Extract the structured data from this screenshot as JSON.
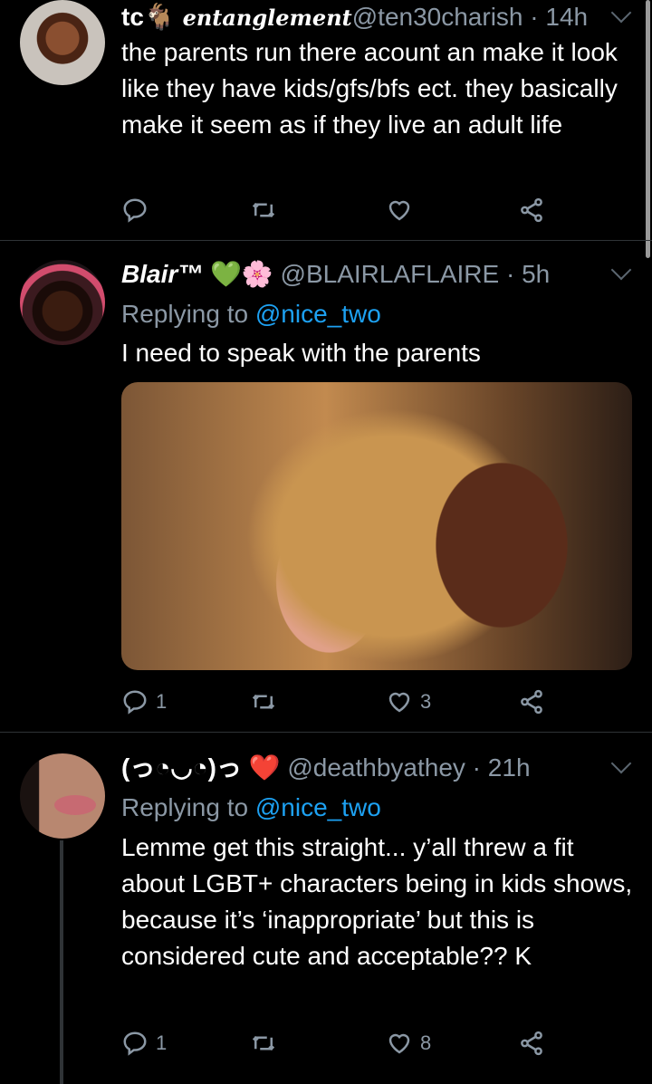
{
  "tweets": [
    {
      "name": "tc",
      "name_decor": "entanglement",
      "handle": "@ten30charish",
      "time": "14h",
      "text": "the parents run there acount an make it look like they have kids/gfs/bfs ect. they basically make it seem as if they live an adult life",
      "replies": "",
      "retweets": "",
      "likes": ""
    },
    {
      "name": "Blair™",
      "name_emoji": "💚🌸",
      "handle": "@BLAIRLAFLAIRE",
      "time": "5h",
      "replying_prefix": "Replying to",
      "replying_handle": "@nice_two",
      "text": "I need to speak with the parents",
      "replies": "1",
      "retweets": "",
      "likes": "3"
    },
    {
      "name": "(っ◔◡◔)っ",
      "name_emoji": "❤️",
      "handle": "@deathbyathey",
      "time": "21h",
      "replying_prefix": "Replying to",
      "replying_handle": "@nice_two",
      "text": "Lemme get this straight... y’all threw a fit about LGBT+ characters being in kids shows, because it’s ‘inappropriate’ but this is considered cute and acceptable?? K",
      "replies": "1",
      "retweets": "",
      "likes": "8"
    }
  ],
  "colors": {
    "background": "#000000",
    "muted": "#8b98a5",
    "link": "#1da1f2",
    "divider": "#2f3336"
  }
}
